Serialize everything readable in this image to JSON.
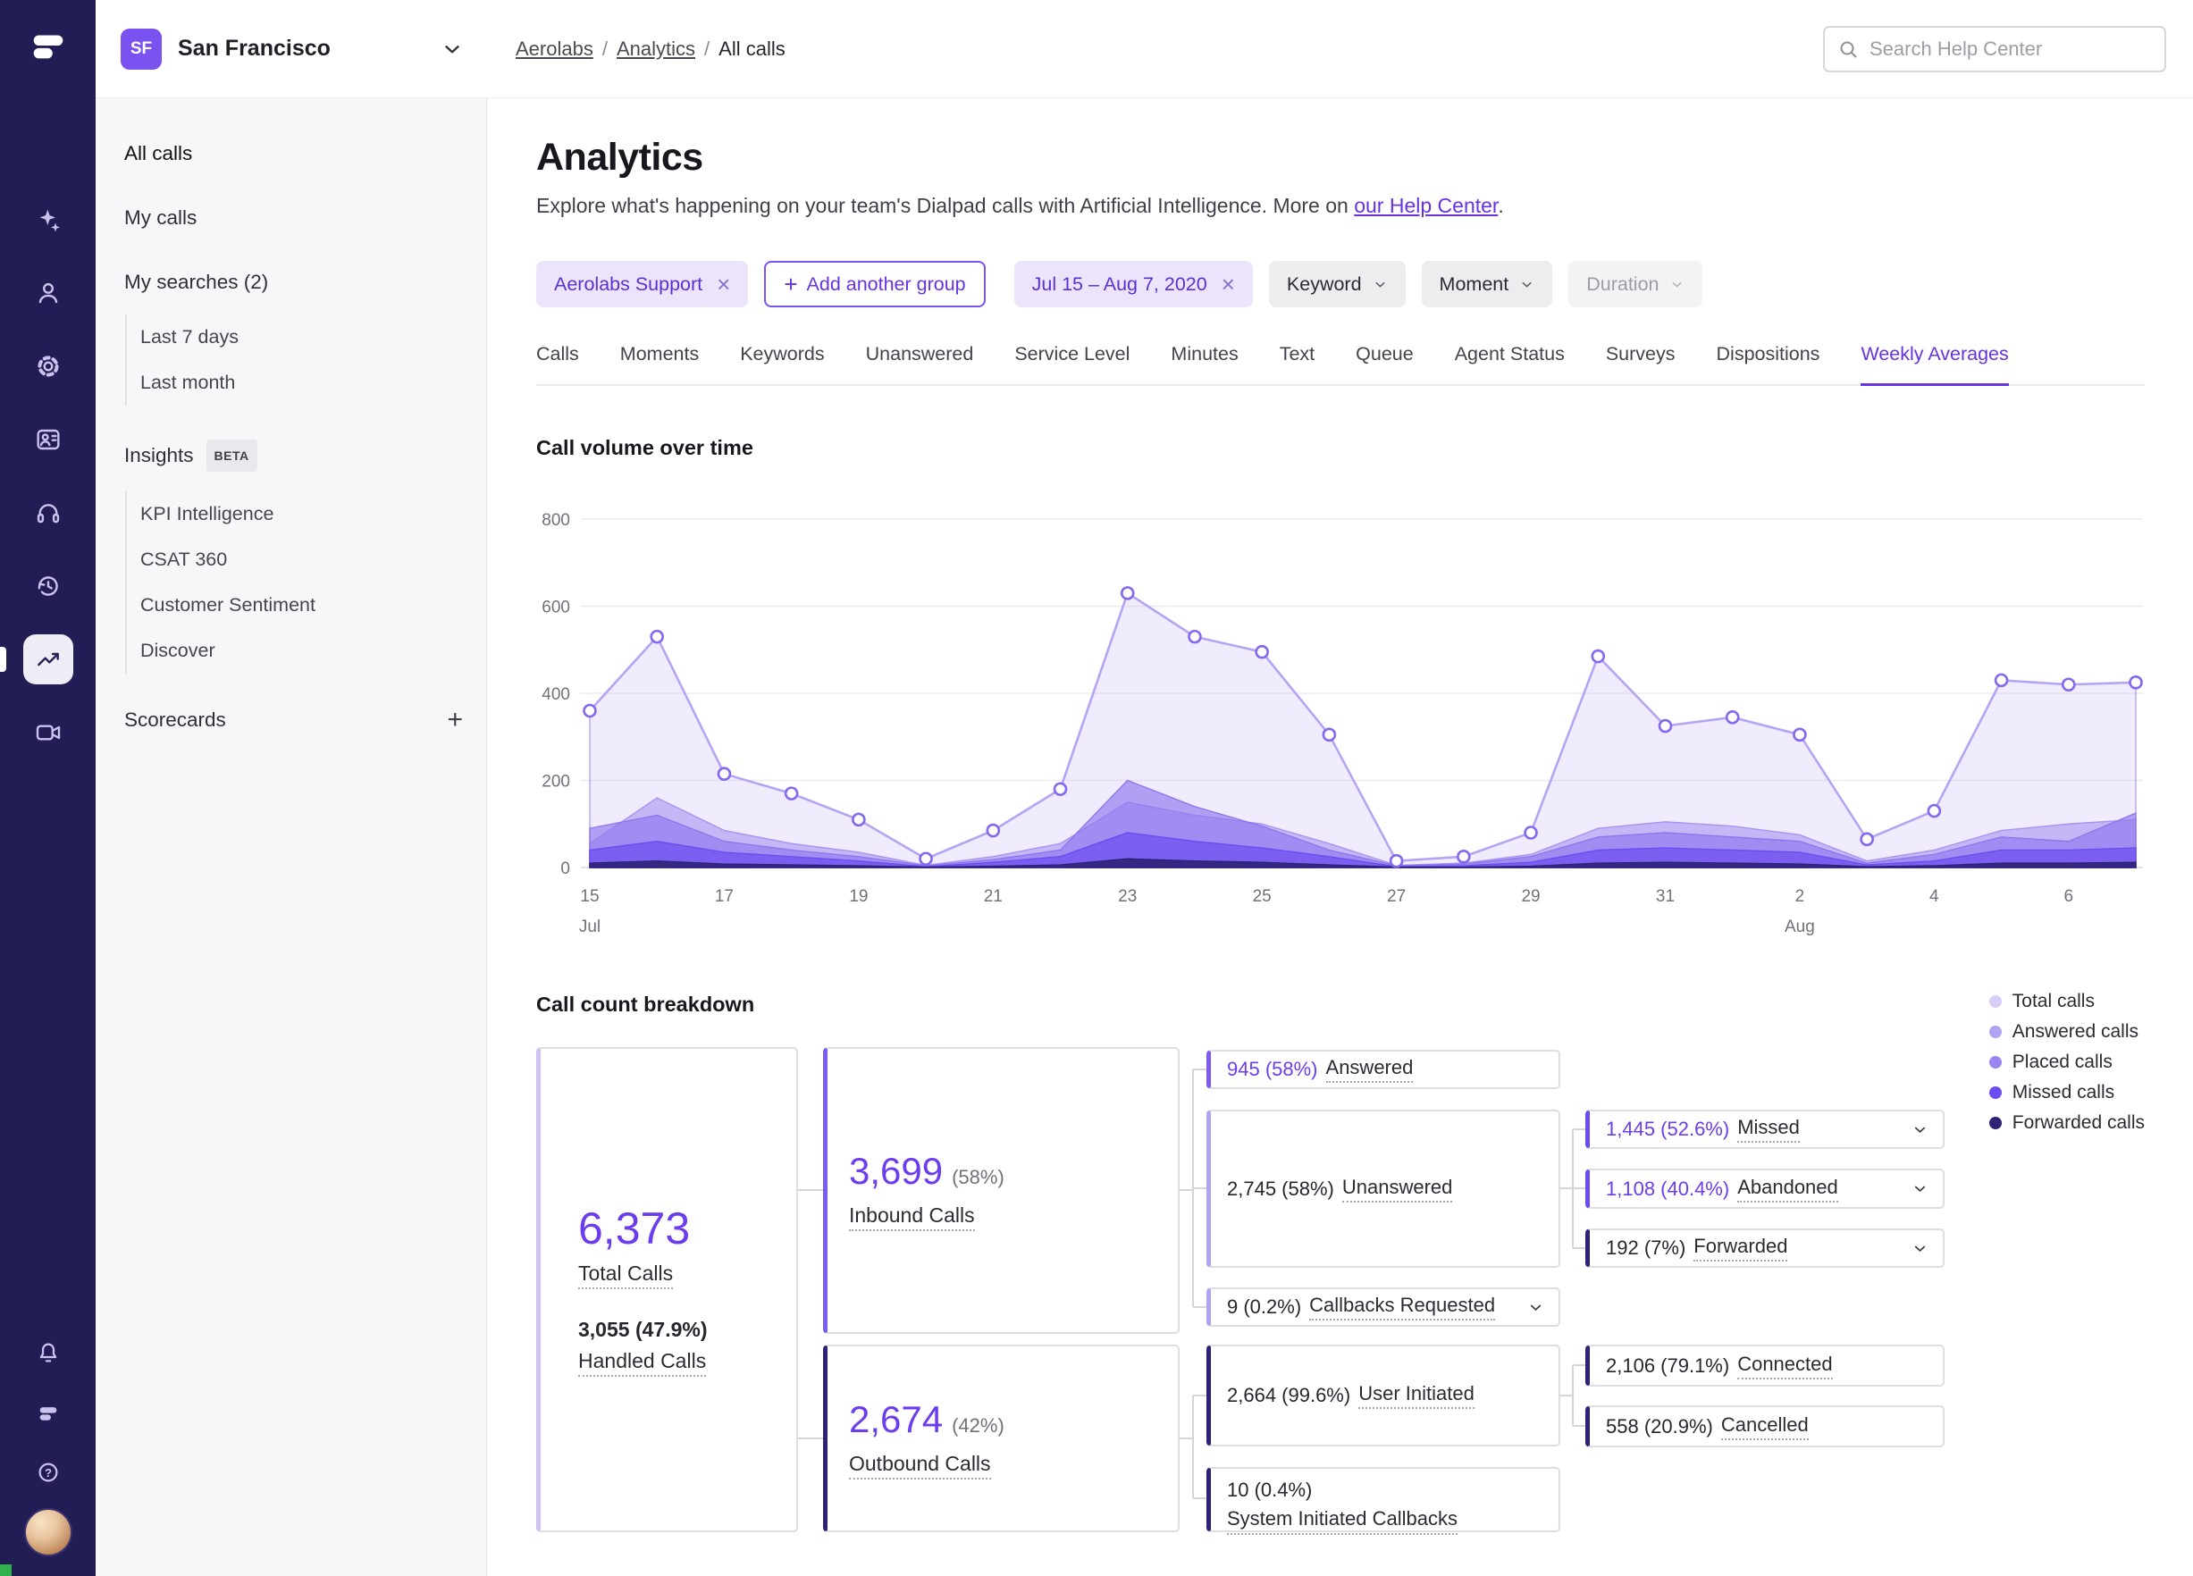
{
  "colors": {
    "purple": "#6c3ded",
    "purple_dark": "#2e2277",
    "link_purple": "#6733e0",
    "rail_background": "#231d55",
    "chip_background": "#ebe4fb",
    "presence_green": "#2fb24c"
  },
  "rail": {
    "icons": [
      "dialpad-logo",
      "ai-assist",
      "contacts",
      "settings",
      "shared-lines",
      "coaching-headset",
      "history",
      "analytics-trend",
      "meetings-settings"
    ],
    "active_icon": "analytics-trend",
    "bottom_icons": [
      "notifications",
      "dialpad-app",
      "help",
      "user-avatar"
    ]
  },
  "topbar": {
    "team_badge": "SF",
    "team_name": "San Francisco",
    "breadcrumb": [
      {
        "label": "Aerolabs",
        "link": true
      },
      {
        "label": "Analytics",
        "link": true
      },
      {
        "label": "All calls",
        "link": false
      }
    ],
    "search_placeholder": "Search Help Center"
  },
  "sidebar": {
    "items": [
      {
        "label": "All calls",
        "type": "item",
        "active": true
      },
      {
        "label": "My calls",
        "type": "item"
      },
      {
        "label": "My searches (2)",
        "type": "item"
      },
      {
        "label": "Last 7 days",
        "type": "sub"
      },
      {
        "label": "Last month",
        "type": "sub"
      },
      {
        "label": "Insights",
        "type": "item",
        "badge": "BETA"
      },
      {
        "label": "KPI Intelligence",
        "type": "sub"
      },
      {
        "label": "CSAT 360",
        "type": "sub"
      },
      {
        "label": "Customer Sentiment",
        "type": "sub"
      },
      {
        "label": "Discover",
        "type": "sub"
      },
      {
        "label": "Scorecards",
        "type": "item",
        "action": "+"
      }
    ]
  },
  "page": {
    "title": "Analytics",
    "description": {
      "prefix": "Explore what's happening on your team's Dialpad calls with Artificial Intelligence. More on ",
      "link": "our Help Center",
      "suffix": "."
    }
  },
  "filters": {
    "chips": [
      {
        "label": "Aerolabs Support",
        "type": "removable"
      },
      {
        "label": "Add another group",
        "type": "add"
      },
      {
        "label": "Jul 15 – Aug 7, 2020",
        "type": "removable"
      },
      {
        "label": "Keyword",
        "type": "dropdown"
      },
      {
        "label": "Moment",
        "type": "dropdown"
      },
      {
        "label": "Duration",
        "type": "dropdown_disabled"
      }
    ]
  },
  "tabs": {
    "items": [
      "Calls",
      "Moments",
      "Keywords",
      "Unanswered",
      "Service Level",
      "Minutes",
      "Text",
      "Queue",
      "Agent Status",
      "Surveys",
      "Dispositions",
      "Weekly Averages"
    ],
    "active": "Weekly Averages"
  },
  "sections": {
    "call_volume_title": "Call volume over time",
    "call_count_title": "Call count breakdown"
  },
  "chart_data": {
    "type": "area",
    "title": "Call volume over time",
    "x": [
      "Jul 15",
      "Jul 16",
      "Jul 17",
      "Jul 18",
      "Jul 19",
      "Jul 20",
      "Jul 21",
      "Jul 22",
      "Jul 23",
      "Jul 24",
      "Jul 25",
      "Jul 26",
      "Jul 27",
      "Jul 28",
      "Jul 29",
      "Jul 30",
      "Jul 31",
      "Aug 1",
      "Aug 2",
      "Aug 3",
      "Aug 4",
      "Aug 5",
      "Aug 6",
      "Aug 7"
    ],
    "ylim": [
      0,
      800
    ],
    "ytick_step": 200,
    "grid": true,
    "legend_position": "none",
    "month_labels": [
      {
        "index": 0,
        "label": "Jul"
      },
      {
        "index": 18,
        "label": "Aug"
      }
    ],
    "marker_stroke": "#8468ee",
    "series": [
      {
        "name": "Total calls",
        "color": "#b5a4f4",
        "fill": "#cdc0f7",
        "fill_opacity": 0.3,
        "markers": true,
        "values": [
          360,
          530,
          215,
          170,
          110,
          20,
          85,
          180,
          630,
          530,
          495,
          305,
          15,
          25,
          80,
          485,
          325,
          345,
          305,
          65,
          130,
          430,
          420,
          425
        ]
      },
      {
        "name": "Answered calls",
        "color": "#a992f1",
        "fill": "#a992f1",
        "fill_opacity": 0.6,
        "markers": false,
        "values": [
          55,
          160,
          85,
          55,
          35,
          5,
          25,
          55,
          150,
          120,
          100,
          55,
          5,
          10,
          30,
          90,
          105,
          95,
          75,
          15,
          40,
          85,
          100,
          110
        ]
      },
      {
        "name": "Placed calls",
        "color": "#8f76ee",
        "fill": "#8f76ee",
        "fill_opacity": 0.65,
        "markers": false,
        "values": [
          90,
          120,
          60,
          40,
          25,
          4,
          18,
          40,
          200,
          140,
          95,
          40,
          4,
          8,
          25,
          70,
          80,
          70,
          60,
          10,
          30,
          70,
          60,
          125
        ]
      },
      {
        "name": "Missed calls",
        "color": "#6c4cf1",
        "fill": "#6c4cf1",
        "fill_opacity": 0.7,
        "markers": false,
        "values": [
          40,
          60,
          35,
          25,
          15,
          2,
          12,
          25,
          80,
          60,
          45,
          25,
          2,
          4,
          12,
          40,
          45,
          40,
          35,
          6,
          15,
          40,
          40,
          45
        ]
      },
      {
        "name": "Forwarded calls",
        "color": "#2e2277",
        "fill": "#2e2277",
        "fill_opacity": 0.9,
        "markers": false,
        "values": [
          10,
          15,
          8,
          6,
          4,
          1,
          3,
          6,
          20,
          15,
          12,
          6,
          1,
          1,
          3,
          10,
          12,
          10,
          8,
          2,
          4,
          10,
          10,
          12
        ]
      }
    ]
  },
  "breakdown": {
    "legend": [
      {
        "label": "Total calls",
        "color": "#d9cdf9"
      },
      {
        "label": "Answered calls",
        "color": "#b2a2f2"
      },
      {
        "label": "Placed calls",
        "color": "#9b85ee"
      },
      {
        "label": "Missed calls",
        "color": "#6c4cf1"
      },
      {
        "label": "Forwarded calls",
        "color": "#2e2277"
      }
    ],
    "nodes": {
      "total": {
        "value": "6,373",
        "label": "Total Calls",
        "sub_value": "3,055 (47.9%)",
        "sub_label": "Handled Calls"
      },
      "inbound": {
        "value": "3,699",
        "pct": "(58%)",
        "label": "Inbound Calls"
      },
      "outbound": {
        "value": "2,674",
        "pct": "(42%)",
        "label": "Outbound Calls"
      },
      "answered": {
        "value": "945 (58%)",
        "label": "Answered"
      },
      "unanswered": {
        "value": "2,745 (58%)",
        "label": "Unanswered"
      },
      "callbacks_requested": {
        "value": "9 (0.2%)",
        "label": "Callbacks Requested"
      },
      "missed": {
        "value": "1,445 (52.6%)",
        "label": "Missed"
      },
      "abandoned": {
        "value": "1,108 (40.4%)",
        "label": "Abandoned"
      },
      "forwarded": {
        "value": "192 (7%)",
        "label": "Forwarded"
      },
      "user_initiated": {
        "value": "2,664 (99.6%)",
        "label": "User Initiated"
      },
      "connected": {
        "value": "2,106 (79.1%)",
        "label": "Connected"
      },
      "cancelled": {
        "value": "558 (20.9%)",
        "label": "Cancelled"
      },
      "system_initiated": {
        "value": "10 (0.4%)",
        "label": "System Initiated Callbacks"
      }
    }
  }
}
